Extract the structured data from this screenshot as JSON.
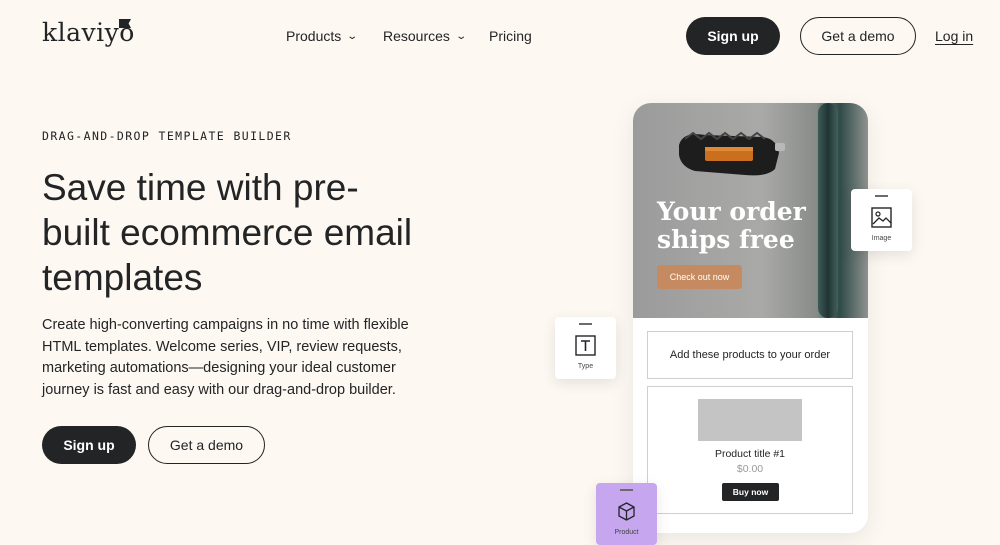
{
  "header": {
    "logo": "klaviyo",
    "nav": [
      {
        "label": "Products",
        "dropdown": true
      },
      {
        "label": "Resources",
        "dropdown": true
      },
      {
        "label": "Pricing",
        "dropdown": false
      }
    ],
    "signup_label": "Sign up",
    "demo_label": "Get a demo",
    "login_label": "Log in"
  },
  "hero": {
    "eyebrow": "DRAG-AND-DROP TEMPLATE BUILDER",
    "headline": "Save time with pre-built ecommerce email templates",
    "description": "Create high-converting campaigns in no time with flexible HTML templates. Welcome series, VIP, review requests, marketing automations—designing your ideal customer journey is fast and easy with our drag-and-drop builder.",
    "signup_label": "Sign up",
    "demo_label": "Get a demo"
  },
  "mockup": {
    "hero_title_line1": "Your order",
    "hero_title_line2": "ships free",
    "checkout_label": "Check out now",
    "add_products_text": "Add these products to your order",
    "product_title": "Product title #1",
    "product_price": "$0.00",
    "buy_label": "Buy now",
    "cards": {
      "type_label": "Type",
      "image_label": "Image",
      "product_label": "Product"
    }
  },
  "colors": {
    "background": "#fdf8f2",
    "dark": "#232426",
    "checkout_button": "#c58a5f",
    "product_card": "#c5a6ef"
  }
}
